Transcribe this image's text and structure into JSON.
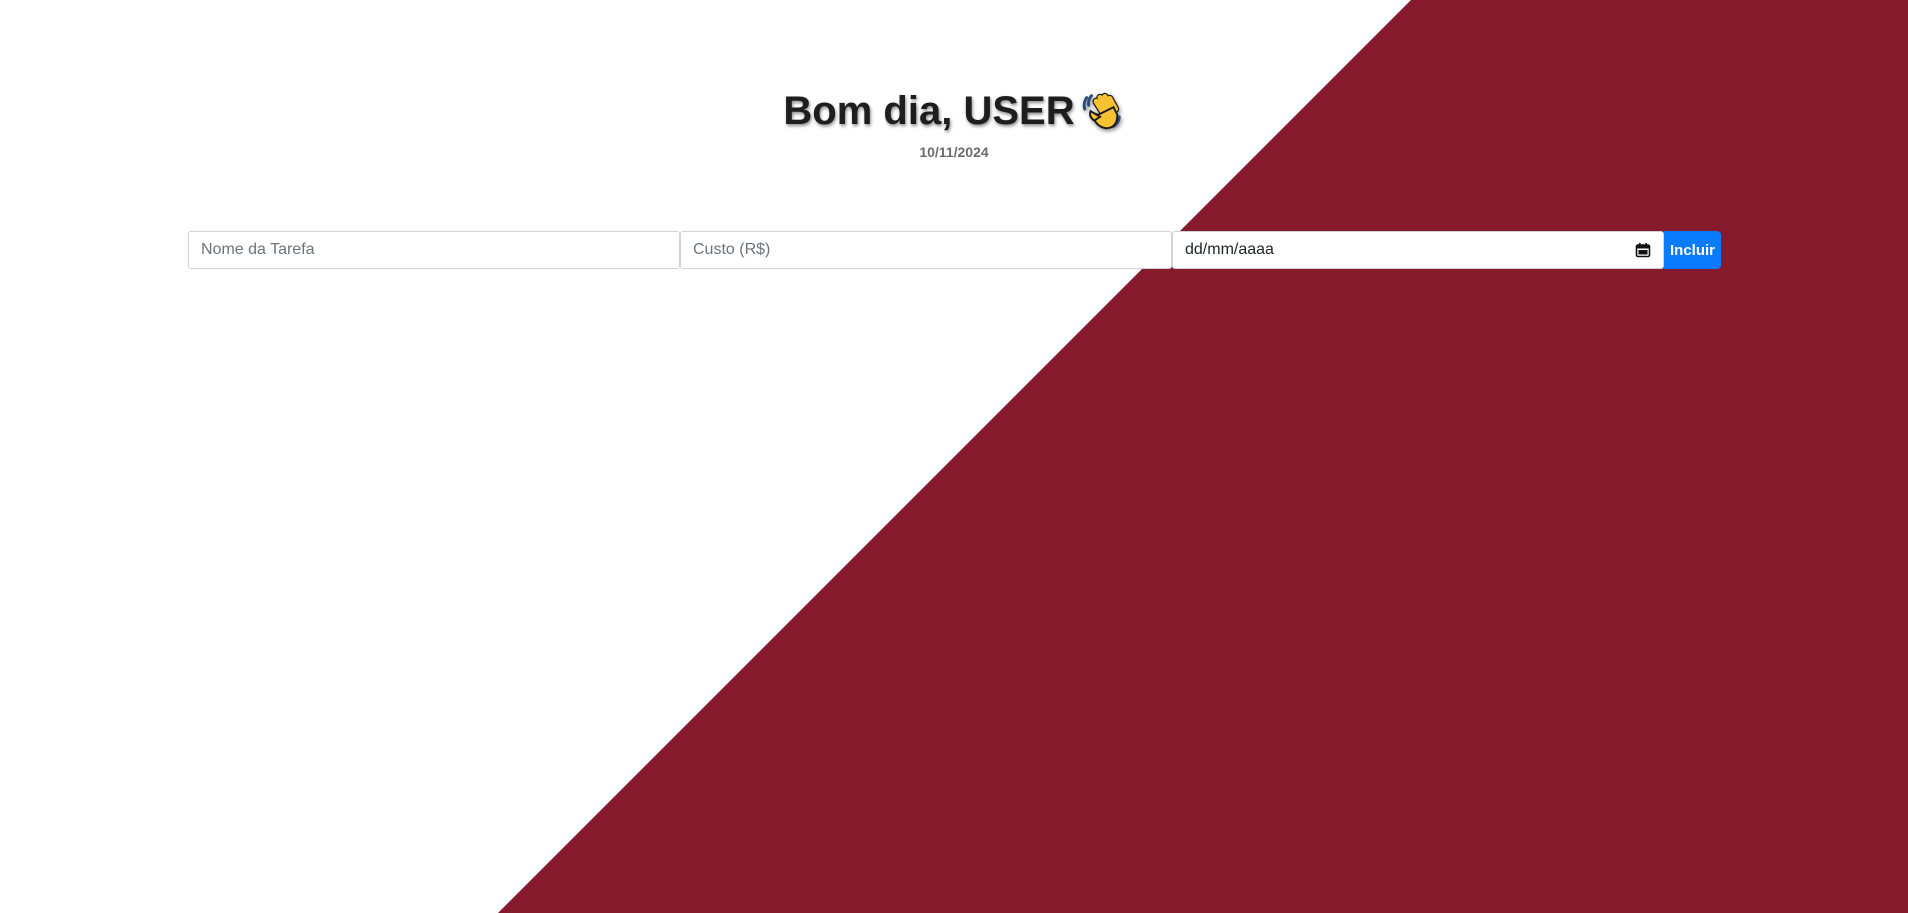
{
  "theme": {
    "background": "#ffffff",
    "diagonal_color": "#841a2b",
    "button_color": "#0b7bfe"
  },
  "header": {
    "greeting": "Bom dia, USER",
    "greeting_icon": "waving-hand-icon",
    "date": "10/11/2024"
  },
  "form": {
    "task_name_placeholder": "Nome da Tarefa",
    "task_name_value": "",
    "cost_placeholder": "Custo (R$)",
    "cost_value": "",
    "date_placeholder": "dd/mm/aaaa",
    "date_icon": "calendar-icon",
    "submit_label": "Incluir"
  }
}
